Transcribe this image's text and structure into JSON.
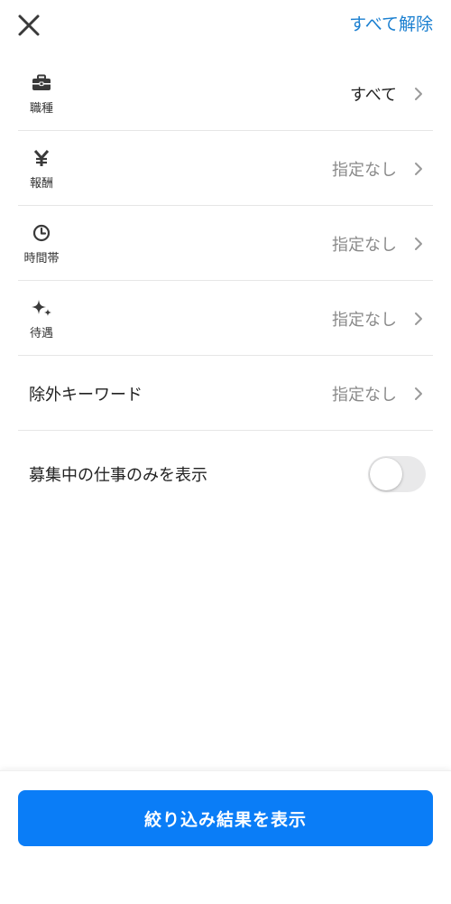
{
  "header": {
    "close_icon": "close-icon",
    "reset_label": "すべて解除"
  },
  "filters": [
    {
      "icon": "briefcase-icon",
      "label": "職種",
      "value": "すべて",
      "selected": true
    },
    {
      "icon": "yen-icon",
      "label": "報酬",
      "value": "指定なし",
      "selected": false
    },
    {
      "icon": "clock-icon",
      "label": "時間帯",
      "value": "指定なし",
      "selected": false
    },
    {
      "icon": "sparkle-icon",
      "label": "待遇",
      "value": "指定なし",
      "selected": false
    }
  ],
  "exclude_keyword": {
    "label": "除外キーワード",
    "value": "指定なし"
  },
  "recruiting_only": {
    "label": "募集中の仕事のみを表示",
    "enabled": false
  },
  "footer": {
    "apply_label": "絞り込み結果を表示"
  },
  "colors": {
    "accent": "#0a7df7",
    "link": "#1a7fd0",
    "muted_text": "#8a8a8a",
    "divider": "#e6e6e6",
    "toggle_off": "#e9e9ea"
  }
}
